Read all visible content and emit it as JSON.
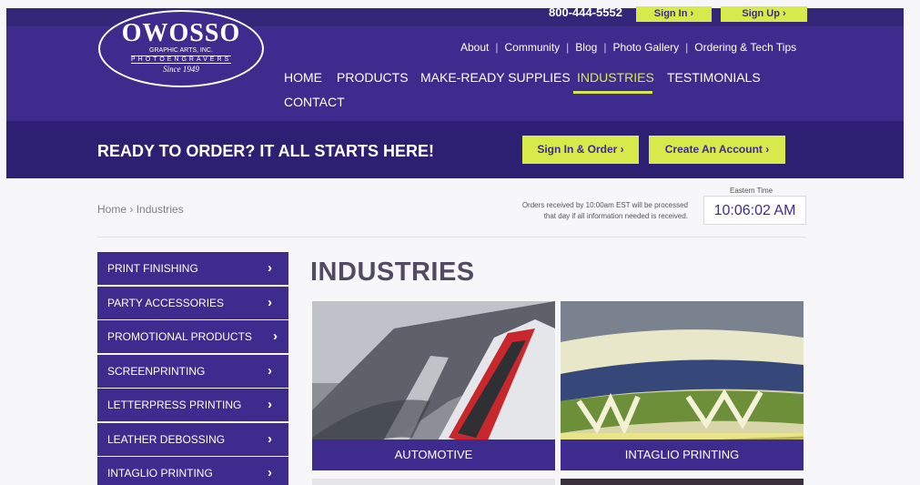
{
  "header": {
    "phone": "800-444-5552",
    "sign_in": "Sign In ›",
    "sign_up": "Sign Up ›",
    "logo": {
      "name": "OWOSSO",
      "line1": "GRAPHIC ARTS, INC.",
      "line2": "PHOTOENGRAVERS",
      "line3": "Since 1949"
    },
    "secondary_nav": [
      "About",
      "Community",
      "Blog",
      "Photo Gallery",
      "Ordering & Tech Tips"
    ],
    "main_nav": [
      "HOME",
      "PRODUCTS",
      "MAKE-READY SUPPLIES",
      "INDUSTRIES",
      "TESTIMONIALS",
      "CONTACT"
    ],
    "active_nav": "INDUSTRIES"
  },
  "cta": {
    "title": "READY TO ORDER? IT ALL STARTS HERE!",
    "order_button": "Sign In & Order ›",
    "create_button": "Create An Account ›"
  },
  "breadcrumb": {
    "home": "Home",
    "separator": "›",
    "current": "Industries"
  },
  "notice": {
    "line1": "Orders received by 10:00am EST will be processed",
    "line2": "that day if all information needed is received."
  },
  "clock": {
    "label": "Eastern Time",
    "time": "10:06:02 AM"
  },
  "sidebar": {
    "chevron": "›",
    "items": [
      "PRINT FINISHING",
      "PARTY ACCESSORIES",
      "PROMOTIONAL PRODUCTS",
      "SCREENPRINTING",
      "LETTERPRESS PRINTING",
      "LEATHER DEBOSSING",
      "INTAGLIO PRINTING"
    ]
  },
  "main": {
    "title": "INDUSTRIES",
    "tiles": [
      "AUTOMOTIVE",
      "INTAGLIO PRINTING"
    ]
  },
  "colors": {
    "brand_purple": "#3d2c8d",
    "dark_purple": "#2d1f71",
    "accent_yellow": "#d7e94b"
  }
}
